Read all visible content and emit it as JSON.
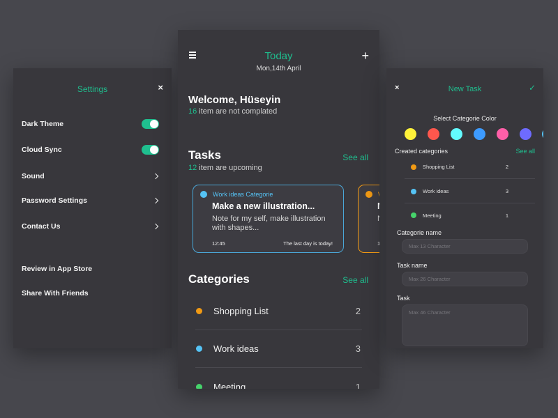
{
  "settings": {
    "title": "Settings",
    "close_icon": "×",
    "toggles": [
      {
        "label": "Dark Theme",
        "on": true
      },
      {
        "label": "Cloud Sync",
        "on": true
      }
    ],
    "links": [
      {
        "label": "Sound"
      },
      {
        "label": "Password Settings"
      },
      {
        "label": "Contact Us"
      }
    ],
    "extra": [
      {
        "label": "Review in App Store"
      },
      {
        "label": "Share With Friends"
      }
    ]
  },
  "main": {
    "header": {
      "title": "Today",
      "date": "Mon,14th April",
      "menu_icon": "hamburger-icon",
      "add_icon": "+"
    },
    "welcome": {
      "title": "Welcome, Hüseyin",
      "count": "16",
      "text": " item are not complated"
    },
    "tasks": {
      "title": "Tasks",
      "see_all": "See all",
      "count": "12",
      "text": " item are upcoming",
      "cards": [
        {
          "category": "Work ideas Categorie",
          "color": "#55c3f5",
          "title": "Make a new illustration...",
          "note": "Note for my self, make illustration with shapes...",
          "time": "12:45",
          "deadline": "The last day is today!"
        },
        {
          "category": "W",
          "color": "#f19a14",
          "title": "M",
          "note": "N w",
          "time": "1",
          "deadline": ""
        }
      ]
    },
    "categories": {
      "title": "Categories",
      "see_all": "See all",
      "items": [
        {
          "name": "Shopping List",
          "count": "2",
          "color": "#f19a14"
        },
        {
          "name": "Work ideas",
          "count": "3",
          "color": "#55c3f5"
        },
        {
          "name": "Meeting",
          "count": "1",
          "color": "#46d36b"
        }
      ]
    }
  },
  "new_task": {
    "title": "New Task",
    "close_icon": "×",
    "confirm_icon": "✓",
    "color_label": "Select Categorie Color",
    "colors": [
      "#fff23a",
      "#ff574d",
      "#63fbff",
      "#3d9bff",
      "#ff5fa8",
      "#6e6bff",
      "#55c3f5"
    ],
    "created_label": "Created categories",
    "see_all": "See all",
    "categories": [
      {
        "name": "Shopping List",
        "count": "2",
        "color": "#f19a14"
      },
      {
        "name": "Work ideas",
        "count": "3",
        "color": "#55c3f5"
      },
      {
        "name": "Meeting",
        "count": "1",
        "color": "#46d36b"
      }
    ],
    "fields": {
      "categorie_name": {
        "label": "Categorie name",
        "placeholder": "Max 13 Character",
        "value": ""
      },
      "task_name": {
        "label": "Task name",
        "placeholder": "Max 26 Character",
        "value": ""
      },
      "task": {
        "label": "Task",
        "placeholder": "Max 46 Character",
        "value": ""
      }
    }
  },
  "colors": {
    "accent": "#1fbf8f",
    "background": "#47474d",
    "panel": "#38373c"
  }
}
